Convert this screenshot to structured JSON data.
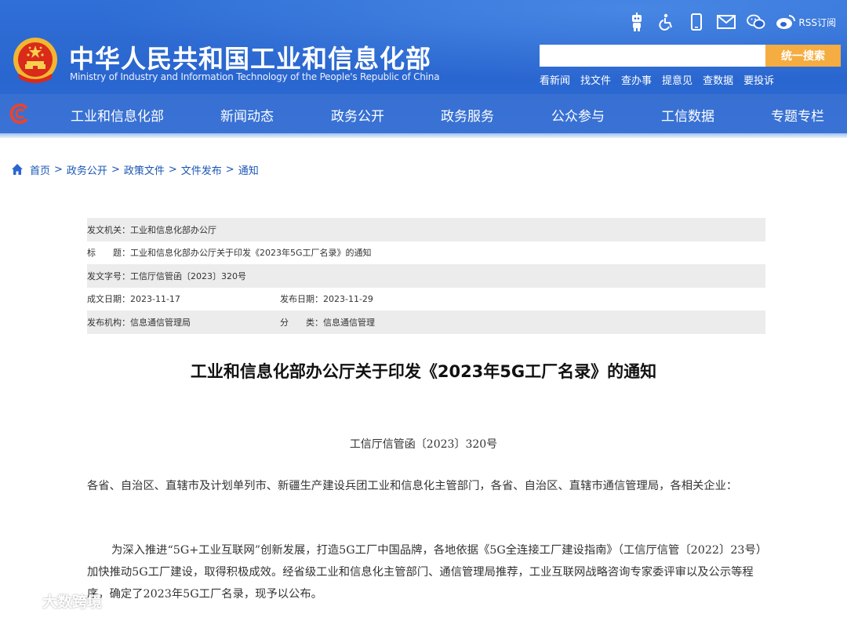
{
  "header": {
    "site_title": "中华人民共和国工业和信息化部",
    "site_subtitle": "Ministry of Industry and Information Technology of the People's Republic of China",
    "toolbar": {
      "icons": [
        "robot-icon",
        "accessibility-icon",
        "mobile-icon",
        "mail-icon",
        "wechat-icon",
        "weibo-icon"
      ],
      "rss_label": "RSS订阅"
    },
    "search": {
      "placeholder": "",
      "value": "",
      "button_label": "统一搜索"
    },
    "quick_links": [
      "看新闻",
      "找文件",
      "查办事",
      "提意见",
      "查数据",
      "要投诉"
    ],
    "nav": [
      "工业和信息化部",
      "新闻动态",
      "政务公开",
      "政务服务",
      "公众参与",
      "工信数据",
      "专题专栏"
    ]
  },
  "breadcrumb": [
    "首页",
    "政务公开",
    "政策文件",
    "文件发布",
    "通知"
  ],
  "meta": {
    "issuer_label": "发文机关：",
    "issuer": "工业和信息化部办公厅",
    "title_label": "标　　题：",
    "title": "工业和信息化部办公厅关于印发《2023年5G工厂名录》的通知",
    "docno_label": "发文字号：",
    "docno": "工信厅信管函〔2023〕320号",
    "created_label": "成文日期：",
    "created": "2023-11-17",
    "published_label": "发布日期：",
    "published": "2023-11-29",
    "org_label": "发布机构：",
    "org": "信息通信管理局",
    "category_label": "分　　类：",
    "category": "信息通信管理"
  },
  "article": {
    "title": "工业和信息化部办公厅关于印发《2023年5G工厂名录》的通知",
    "doc_number": "工信厅信管函〔2023〕320号",
    "para1": "各省、自治区、直辖市及计划单列市、新疆生产建设兵团工业和信息化主管部门，各省、自治区、直辖市通信管理局，各相关企业：",
    "para2": "为深入推进“5G+工业互联网”创新发展，打造5G工厂中国品牌，各地依据《5G全连接工厂建设指南》（工信厅信管〔2022〕23号）加快推动5G工厂建设，取得积极成效。经省级工业和信息化主管部门、通信管理局推荐，工业互联网战略咨询专家委评审以及公示等程序，确定了2023年5G工厂名录，现予以公布。"
  },
  "watermark": {
    "text": "大数跨境"
  },
  "colors": {
    "header_blue": "#2a66cf",
    "search_button": "#f5ac40",
    "link_blue": "#1a56b4",
    "meta_shade": "#ececec"
  }
}
